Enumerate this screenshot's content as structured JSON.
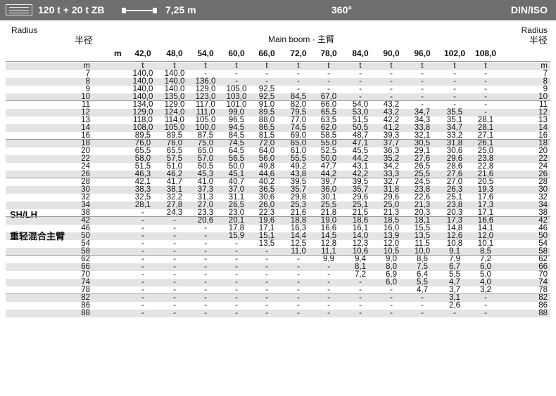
{
  "header": {
    "config": "120 t + 20 t ZB",
    "superlift": "7,25 m",
    "rotation": "360°",
    "standard": "DIN/ISO"
  },
  "table": {
    "radius_label_en": "Radius",
    "radius_label_cn": "半径",
    "main_boom_label": "Main boom · 主臂",
    "boom_unit": "m",
    "radius_unit": "m",
    "load_unit": "t",
    "boom_lengths": [
      "42,0",
      "48,0",
      "54,0",
      "60,0",
      "66,0",
      "72,0",
      "78,0",
      "84,0",
      "90,0",
      "96,0",
      "102,0",
      "108,0"
    ],
    "rows": [
      {
        "r": "7",
        "v": [
          "140,0",
          "140,0",
          "-",
          "-",
          "-",
          "-",
          "-",
          "-",
          "-",
          "-",
          "-",
          "-"
        ]
      },
      {
        "r": "8",
        "v": [
          "140,0",
          "140,0",
          "136,0",
          "-",
          "-",
          "-",
          "-",
          "-",
          "-",
          "-",
          "-",
          "-"
        ]
      },
      {
        "r": "9",
        "v": [
          "140,0",
          "140,0",
          "129,0",
          "105,0",
          "92,5",
          "-",
          "-",
          "-",
          "-",
          "-",
          "-",
          "-"
        ]
      },
      {
        "r": "10",
        "v": [
          "140,0",
          "135,0",
          "123,0",
          "103,0",
          "92,5",
          "84,5",
          "67,0",
          "-",
          "-",
          "-",
          "-",
          "-"
        ]
      },
      {
        "r": "11",
        "v": [
          "134,0",
          "129,0",
          "117,0",
          "101,0",
          "91,0",
          "82,0",
          "66,0",
          "54,0",
          "43,2",
          "-",
          "-",
          "-"
        ]
      },
      {
        "r": "12",
        "v": [
          "129,0",
          "124,0",
          "111,0",
          "99,0",
          "89,5",
          "79,5",
          "65,5",
          "53,0",
          "43,2",
          "34,7",
          "35,5",
          "-"
        ]
      },
      {
        "r": "13",
        "v": [
          "118,0",
          "114,0",
          "105,0",
          "96,5",
          "88,0",
          "77,0",
          "63,5",
          "51,5",
          "42,2",
          "34,3",
          "35,1",
          "28,1"
        ]
      },
      {
        "r": "14",
        "v": [
          "108,0",
          "105,0",
          "100,0",
          "94,5",
          "86,5",
          "74,5",
          "62,0",
          "50,5",
          "41,2",
          "33,8",
          "34,7",
          "28,1"
        ]
      },
      {
        "r": "16",
        "v": [
          "89,5",
          "89,5",
          "87,5",
          "84,5",
          "81,5",
          "69,0",
          "58,5",
          "48,7",
          "39,3",
          "32,1",
          "33,2",
          "27,1"
        ]
      },
      {
        "r": "18",
        "v": [
          "76,0",
          "76,0",
          "75,0",
          "74,5",
          "72,0",
          "65,0",
          "55,0",
          "47,1",
          "37,7",
          "30,5",
          "31,8",
          "26,1"
        ]
      },
      {
        "r": "20",
        "v": [
          "65,5",
          "65,5",
          "65,0",
          "64,5",
          "64,0",
          "61,0",
          "52,5",
          "45,5",
          "36,3",
          "29,1",
          "30,6",
          "25,0"
        ]
      },
      {
        "r": "22",
        "v": [
          "58,0",
          "57,5",
          "57,0",
          "56,5",
          "56,0",
          "55,5",
          "50,0",
          "44,2",
          "35,2",
          "27,6",
          "29,6",
          "23,8"
        ]
      },
      {
        "r": "24",
        "v": [
          "51,5",
          "51,0",
          "50,5",
          "50,0",
          "49,8",
          "49,2",
          "47,7",
          "43,1",
          "34,2",
          "26,5",
          "28,6",
          "22,8"
        ]
      },
      {
        "r": "26",
        "v": [
          "46,3",
          "46,2",
          "45,3",
          "45,1",
          "44,6",
          "43,8",
          "44,2",
          "42,2",
          "33,3",
          "25,5",
          "27,6",
          "21,6"
        ]
      },
      {
        "r": "28",
        "v": [
          "42,1",
          "41,7",
          "41,0",
          "40,7",
          "40,2",
          "39,5",
          "39,7",
          "39,5",
          "32,7",
          "24,5",
          "27,0",
          "20,5"
        ]
      },
      {
        "r": "30",
        "v": [
          "38,3",
          "38,1",
          "37,3",
          "37,0",
          "36,5",
          "35,7",
          "36,0",
          "35,7",
          "31,8",
          "23,8",
          "26,3",
          "19,3"
        ]
      },
      {
        "r": "32",
        "v": [
          "32,5",
          "32,2",
          "31,3",
          "31,1",
          "30,6",
          "29,8",
          "30,1",
          "29,6",
          "29,6",
          "22,6",
          "25,1",
          "17,6"
        ]
      },
      {
        "r": "34",
        "v": [
          "28,1",
          "27,8",
          "27,0",
          "26,5",
          "26,0",
          "25,3",
          "25,5",
          "25,1",
          "25,0",
          "21,3",
          "23,8",
          "17,3"
        ]
      },
      {
        "r": "38",
        "v": [
          "-",
          "24,3",
          "23,3",
          "23,0",
          "22,3",
          "21,6",
          "21,8",
          "21,5",
          "21,3",
          "20,3",
          "20,3",
          "17,1"
        ]
      },
      {
        "r": "42",
        "v": [
          "-",
          "-",
          "20,6",
          "20,1",
          "19,6",
          "18,8",
          "19,0",
          "18,6",
          "18,5",
          "18,1",
          "17,3",
          "16,6"
        ]
      },
      {
        "r": "46",
        "v": [
          "-",
          "-",
          "-",
          "17,8",
          "17,1",
          "16,3",
          "16,6",
          "16,1",
          "16,0",
          "15,5",
          "14,8",
          "14,1"
        ]
      },
      {
        "r": "50",
        "v": [
          "-",
          "-",
          "-",
          "15,9",
          "15,1",
          "14,4",
          "14,5",
          "14,0",
          "13,9",
          "13,5",
          "12,6",
          "12,0"
        ]
      },
      {
        "r": "54",
        "v": [
          "-",
          "-",
          "-",
          "-",
          "13,5",
          "12,5",
          "12,8",
          "12,3",
          "12,0",
          "11,5",
          "10,8",
          "10,1"
        ]
      },
      {
        "r": "58",
        "v": [
          "-",
          "-",
          "-",
          "-",
          "-",
          "11,0",
          "11,1",
          "10,6",
          "10,5",
          "10,0",
          "9,1",
          "8,5"
        ]
      },
      {
        "r": "62",
        "v": [
          "-",
          "-",
          "-",
          "-",
          "-",
          "-",
          "9,9",
          "9,4",
          "9,0",
          "8,6",
          "7,9",
          "7,2"
        ]
      },
      {
        "r": "66",
        "v": [
          "-",
          "-",
          "-",
          "-",
          "-",
          "-",
          "-",
          "8,1",
          "8,0",
          "7,5",
          "6,7",
          "6,0"
        ]
      },
      {
        "r": "70",
        "v": [
          "-",
          "-",
          "-",
          "-",
          "-",
          "-",
          "-",
          "7,2",
          "6,9",
          "6,4",
          "5,5",
          "5,0"
        ]
      },
      {
        "r": "74",
        "v": [
          "-",
          "-",
          "-",
          "-",
          "-",
          "-",
          "-",
          "-",
          "6,0",
          "5,5",
          "4,7",
          "4,0"
        ]
      },
      {
        "r": "78",
        "v": [
          "-",
          "-",
          "-",
          "-",
          "-",
          "-",
          "-",
          "-",
          "-",
          "4,7",
          "3,7",
          "3,2"
        ]
      },
      {
        "r": "82",
        "v": [
          "-",
          "-",
          "-",
          "-",
          "-",
          "-",
          "-",
          "-",
          "-",
          "-",
          "3,1",
          "-"
        ]
      },
      {
        "r": "86",
        "v": [
          "-",
          "-",
          "-",
          "-",
          "-",
          "-",
          "-",
          "-",
          "-",
          "-",
          "2,6",
          "-"
        ]
      },
      {
        "r": "88",
        "v": [
          "-",
          "-",
          "-",
          "-",
          "-",
          "-",
          "-",
          "-",
          "-",
          "-",
          "-",
          "-"
        ]
      }
    ]
  },
  "configuration": {
    "code": "SH/LH",
    "name_cn": "重轻混合主臂"
  }
}
